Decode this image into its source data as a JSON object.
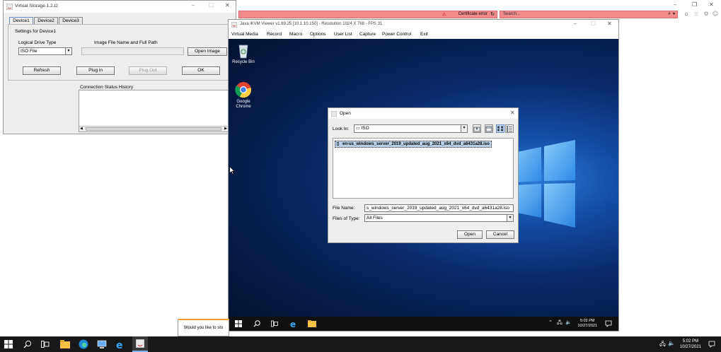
{
  "browser": {
    "cert_error": "Certificate error",
    "search_placeholder": "Search..."
  },
  "virtual_storage": {
    "title": "Virtual Storage 1.2.t2",
    "tabs": [
      "Device1",
      "Device2",
      "Device3"
    ],
    "settings_title": "Settings for Device1",
    "logical_drive_label": "Logical Drive Type",
    "logical_drive_value": "ISO File",
    "image_file_label": "Image File Name and Full Path",
    "image_file_value": "",
    "open_image_label": "Open Image",
    "refresh_label": "Refresh",
    "plug_in_label": "Plug in",
    "plug_out_label": "Plug Out",
    "ok_label": "OK",
    "connection_history_label": "Connection Status History"
  },
  "kvm": {
    "title": "Java iKVM Viewer v1.69.25 [10.1.10.150]  - Resolution 1024 X 768 - FPS 31",
    "menu": [
      "Virtual Media",
      "Record",
      "Macro",
      "Options",
      "User List",
      "Capture",
      "Power Control",
      "Exit"
    ],
    "desktop_icons": [
      "Recycle Bin",
      "Google Chrome"
    ],
    "clock_time": "5:02 PM",
    "clock_date": "10/27/2021"
  },
  "open_dialog": {
    "title": "Open",
    "look_in_label": "Look In:",
    "look_in_value": "ISO",
    "file_entry": "en-us_windows_server_2019_updated_aug_2021_x64_dvd_a6431a28.iso",
    "file_name_label": "File Name:",
    "file_name_value": "s_windows_server_2019_updated_aug_2021_x64_dvd_a6431a28.iso",
    "files_of_type_label": "Files of Type:",
    "files_of_type_value": "All Files",
    "open_button": "Open",
    "cancel_button": "Cancel"
  },
  "popup": {
    "text": "Would you like to sto"
  },
  "host_taskbar": {
    "clock_time": "5:02 PM",
    "clock_date": "10/27/2021"
  },
  "colors": {
    "addr_error": "#f28b8b",
    "desktop_blue": "#114aa0",
    "taskbar": "#181818"
  }
}
